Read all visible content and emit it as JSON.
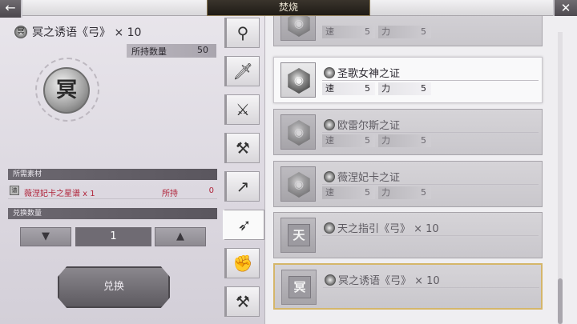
{
  "header": {
    "title": "焚烧",
    "back_icon": "←",
    "close_icon": "✕"
  },
  "item": {
    "badge": "冥",
    "name": "冥之诱语《弓》 × 10",
    "own_label": "所持数量",
    "own_value": "50",
    "medal_glyph": "冥"
  },
  "materials": {
    "header": "所需素材",
    "row": {
      "icon": "谱",
      "name": "薇涅妃卡之星谱 x 1",
      "hold_label": "所持",
      "hold_value": "0"
    }
  },
  "quantity": {
    "header": "兑换数量",
    "value": "1",
    "down": "▼",
    "up": "▲"
  },
  "exchange_label": "兑换",
  "tabs": [
    {
      "icon": "staff-icon",
      "glyph": "⚲"
    },
    {
      "icon": "sword-icon",
      "glyph": "🗡"
    },
    {
      "icon": "dagger-icon",
      "glyph": "⚔"
    },
    {
      "icon": "axe-icon",
      "glyph": "⚒"
    },
    {
      "icon": "spear-icon",
      "glyph": "↗"
    },
    {
      "icon": "bow-icon",
      "glyph": "➶"
    },
    {
      "icon": "fist-icon",
      "glyph": "✊"
    },
    {
      "icon": "hammer-icon",
      "glyph": "⚒"
    }
  ],
  "list": [
    {
      "name": "",
      "stat1_label": "速",
      "stat1": "5",
      "stat2_label": "力",
      "stat2": "5",
      "kind": "gem",
      "state": "dim"
    },
    {
      "name": "圣歌女神之证",
      "stat1_label": "速",
      "stat1": "5",
      "stat2_label": "力",
      "stat2": "5",
      "kind": "gem",
      "state": "active"
    },
    {
      "name": "欧雷尔斯之证",
      "stat1_label": "速",
      "stat1": "5",
      "stat2_label": "力",
      "stat2": "5",
      "kind": "gem",
      "state": "dim"
    },
    {
      "name": "薇涅妃卡之证",
      "stat1_label": "速",
      "stat1": "5",
      "stat2_label": "力",
      "stat2": "5",
      "kind": "gem",
      "state": "dim"
    },
    {
      "name": "天之指引《弓》 × 10",
      "seal": "天",
      "kind": "seal",
      "state": "dim"
    },
    {
      "name": "冥之诱语《弓》 × 10",
      "seal": "冥",
      "kind": "seal",
      "state": "selected"
    }
  ]
}
